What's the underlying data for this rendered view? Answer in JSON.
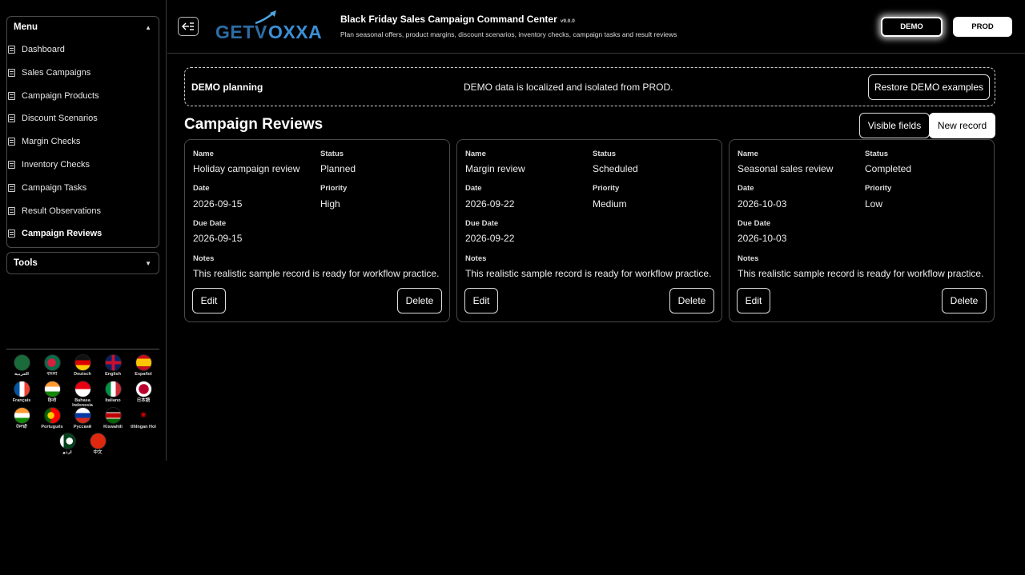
{
  "sidebar": {
    "menu_title": "Menu",
    "tools_title": "Tools",
    "items": [
      {
        "label": "Dashboard"
      },
      {
        "label": "Sales Campaigns"
      },
      {
        "label": "Campaign Products"
      },
      {
        "label": "Discount Scenarios"
      },
      {
        "label": "Margin Checks"
      },
      {
        "label": "Inventory Checks"
      },
      {
        "label": "Campaign Tasks"
      },
      {
        "label": "Result Observations"
      },
      {
        "label": "Campaign Reviews"
      }
    ],
    "active_item": "Campaign Reviews",
    "languages": [
      {
        "label": "العربية",
        "icon": "saudi-flag"
      },
      {
        "label": "বাংলা",
        "icon": "bangladesh-flag"
      },
      {
        "label": "Deutsch",
        "icon": "germany-flag"
      },
      {
        "label": "English",
        "icon": "uk-flag"
      },
      {
        "label": "Español",
        "icon": "spain-flag"
      },
      {
        "label": "Français",
        "icon": "france-flag"
      },
      {
        "label": "हिन्दी",
        "icon": "india-flag"
      },
      {
        "label": "Bahasa Indonesia",
        "icon": "indonesia-flag"
      },
      {
        "label": "Italiano",
        "icon": "italy-flag"
      },
      {
        "label": "日本語",
        "icon": "japan-flag"
      },
      {
        "label": "ਪੰਜਾਬੀ",
        "icon": "india-flag"
      },
      {
        "label": "Português",
        "icon": "portugal-flag"
      },
      {
        "label": "Русский",
        "icon": "russia-flag"
      },
      {
        "label": "Kiswahili",
        "icon": "kenya-flag"
      },
      {
        "label": "tlhIngan Hol",
        "icon": "klingon-emblem"
      },
      {
        "label": "اردو",
        "icon": "pakistan-flag"
      },
      {
        "label": "中文",
        "icon": "china-flag"
      }
    ]
  },
  "header": {
    "logo_text": "GETVOXXA",
    "title": "Black Friday Sales Campaign Command Center",
    "version": "v9.0.0",
    "subtitle": "Plan seasonal offers, product margins, discount scenarios, inventory checks, campaign tasks and result reviews",
    "demo_label": "DEMO",
    "prod_label": "PROD"
  },
  "banner": {
    "label": "DEMO planning",
    "message": "DEMO data is localized and isolated from PROD.",
    "restore_label": "Restore DEMO examples"
  },
  "main": {
    "title": "Campaign Reviews",
    "visible_fields_label": "Visible fields",
    "new_record_label": "New record",
    "field_labels": {
      "name": "Name",
      "status": "Status",
      "date": "Date",
      "priority": "Priority",
      "due_date": "Due Date",
      "notes": "Notes"
    },
    "edit_label": "Edit",
    "delete_label": "Delete",
    "records": [
      {
        "name": "Holiday campaign review",
        "status": "Planned",
        "date": "2026-09-15",
        "priority": "High",
        "due_date": "2026-09-15",
        "notes": "This realistic sample record is ready for workflow practice."
      },
      {
        "name": "Margin review",
        "status": "Scheduled",
        "date": "2026-09-22",
        "priority": "Medium",
        "due_date": "2026-09-22",
        "notes": "This realistic sample record is ready for workflow practice."
      },
      {
        "name": "Seasonal sales review",
        "status": "Completed",
        "date": "2026-10-03",
        "priority": "Low",
        "due_date": "2026-10-03",
        "notes": "This realistic sample record is ready for workflow practice."
      }
    ]
  },
  "colors": {
    "background": "#000000",
    "text": "#ffffff",
    "border": "#4a4a4a",
    "logo_blue": "#2e6da4"
  }
}
